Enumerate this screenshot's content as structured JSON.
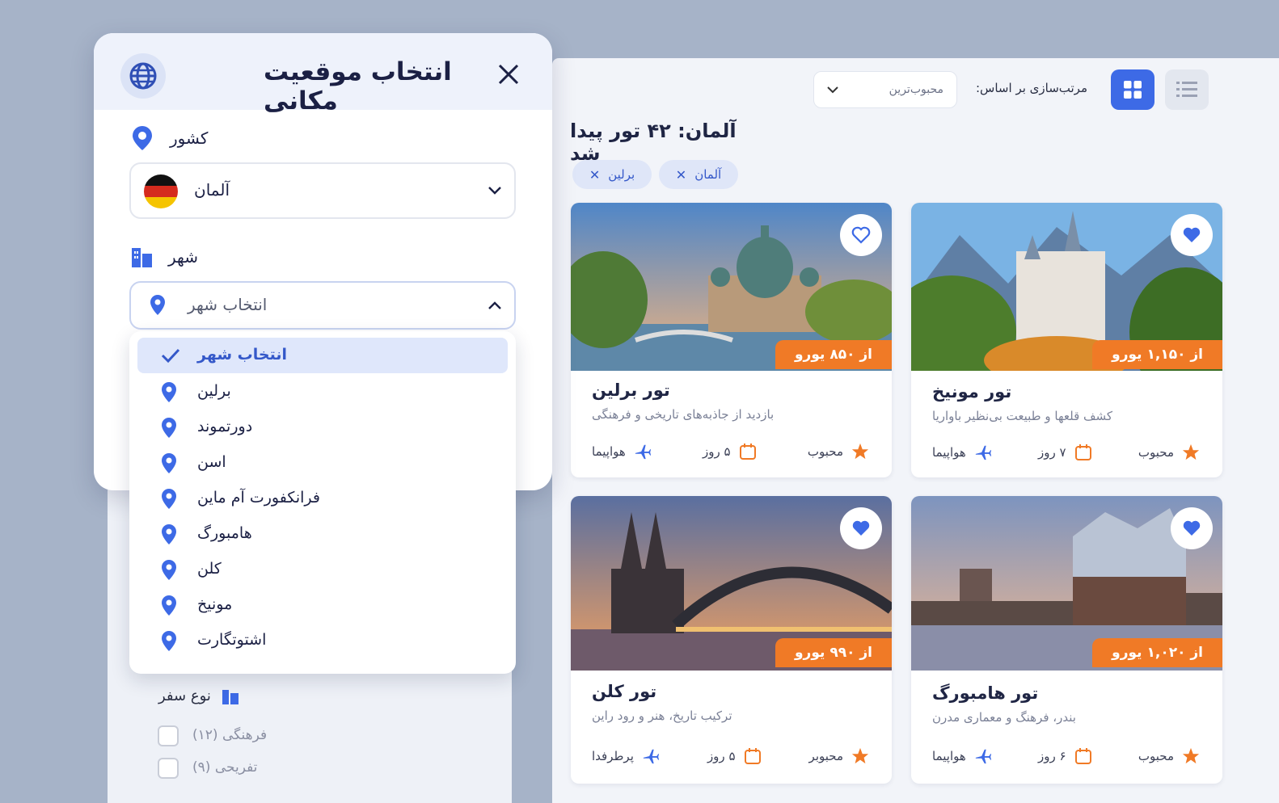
{
  "colors": {
    "accent": "#3d6ae6",
    "price": "#f07a26",
    "star": "#f07a26"
  },
  "toolbar": {
    "grid_view_icon": "grid-icon",
    "list_view_icon": "list-icon",
    "sort_label": "مرتب‌سازی بر اساس:",
    "sort_value": "محبوب‌ترین"
  },
  "results": {
    "title": "آلمان: ۴۲ تور پیدا شد",
    "chips": [
      "آلمان",
      "برلین"
    ]
  },
  "cards": [
    {
      "title": "تور برلین",
      "desc": "بازدید از جاذبه‌های تاریخی و فرهنگی",
      "price": "از ۸۵۰ یورو",
      "tag": "محبوب",
      "duration": "۵ روز",
      "transport": "هواپیما"
    },
    {
      "title": "تور مونیخ",
      "desc": "کشف قلعها و طبیعت بی‌نظیر باواریا",
      "price": "از ۱,۱۵۰ یورو",
      "tag": "محبوب",
      "duration": "۷ روز",
      "transport": "هواپیما"
    },
    {
      "title": "تور کلن",
      "desc": "ترکیب تاریخ، هنر و رود راین",
      "price": "از ۹۹۰ یورو",
      "tag": "محبوبر",
      "duration": "۵ روز",
      "transport": "پرطرفدا"
    },
    {
      "title": "تور هامبورگ",
      "desc": "بندر، فرهنگ و معماری مدرن",
      "price": "از ۱,۰۲۰ یورو",
      "tag": "محبوب",
      "duration": "۶ روز",
      "transport": "هواپیما"
    }
  ],
  "modal": {
    "title": "انتخاب موقعیت مکانی",
    "country_label": "کشور",
    "country_value": "آلمان",
    "city_label": "شهر",
    "city_placeholder": "انتخاب شهر",
    "city_options": [
      "انتخاب شهر",
      "برلین",
      "دورتموند",
      "اسن",
      "فرانکفورت آم ماین",
      "هامبورگ",
      "کلن",
      "مونیخ",
      "اشتوتگارت"
    ]
  },
  "filters": {
    "trip_type_label": "نوع سفر",
    "options": [
      "فرهنگی (۱۲)",
      "تفریحی (۹)"
    ]
  }
}
